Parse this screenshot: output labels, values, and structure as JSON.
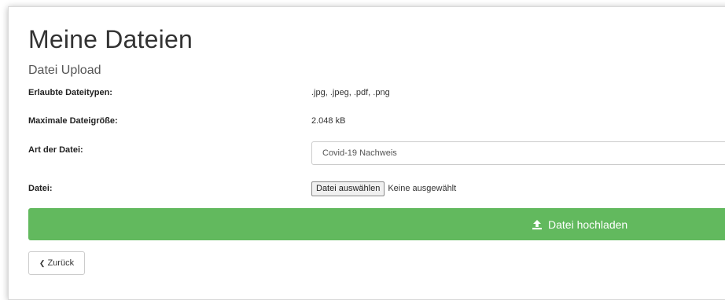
{
  "page": {
    "title": "Meine Dateien",
    "subtitle": "Datei Upload"
  },
  "fields": {
    "types": {
      "label": "Erlaubte Dateitypen:",
      "value": ".jpg, .jpeg, .pdf, .png"
    },
    "maxsize": {
      "label": "Maximale Dateigröße:",
      "value": "2.048 kB"
    },
    "filetype": {
      "label": "Art der Datei:",
      "selected": "Covid-19 Nachweis"
    },
    "file": {
      "label": "Datei:",
      "button": "Datei auswählen",
      "status": "Keine ausgewählt"
    }
  },
  "actions": {
    "upload_label": "Datei hochladen",
    "upload_icon": "upload-icon",
    "back_label": "Zurück",
    "back_icon": "chevron-left-icon"
  },
  "colors": {
    "upload_bg": "#62b95e",
    "text": "#333333"
  }
}
